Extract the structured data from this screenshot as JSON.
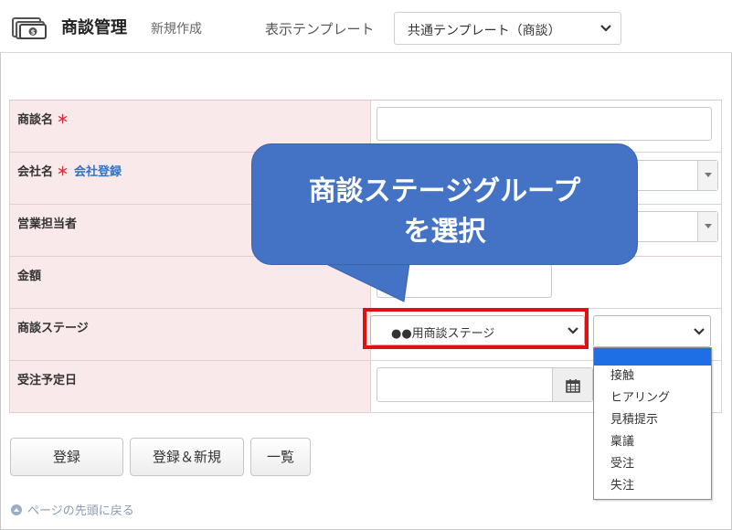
{
  "header": {
    "icon": "money-icon",
    "title": "商談管理",
    "subtitle": "新規作成",
    "template_label": "表示テンプレート",
    "template_value": "共通テンプレート（商談）"
  },
  "form": {
    "deal_name": {
      "label": "商談名",
      "required": "＊",
      "value": ""
    },
    "company": {
      "label": "会社名",
      "required": "＊",
      "link": "会社登録",
      "value": ""
    },
    "sales_rep": {
      "label": "営業担当者",
      "value": ""
    },
    "amount": {
      "label": "金額",
      "value": ""
    },
    "stage": {
      "label": "商談ステージ",
      "group_value": "●●用商談ステージ",
      "stage_value": ""
    },
    "order_date": {
      "label": "受注予定日",
      "value": ""
    }
  },
  "stage_options": [
    "",
    "接触",
    "ヒアリング",
    "見積提示",
    "稟議",
    "受注",
    "失注"
  ],
  "buttons": {
    "register": "登録",
    "register_new": "登録＆新規",
    "list": "一覧"
  },
  "back_to_top": "ページの先頭に戻る",
  "callout": {
    "line1": "商談ステージグループ",
    "line2": "を選択"
  },
  "colors": {
    "label_bg": "#f9e9ea",
    "required": "#d9323a",
    "link": "#2f73c7",
    "callout": "#4472c4",
    "highlight": "#e01010",
    "selected_option": "#1e6fe6"
  }
}
